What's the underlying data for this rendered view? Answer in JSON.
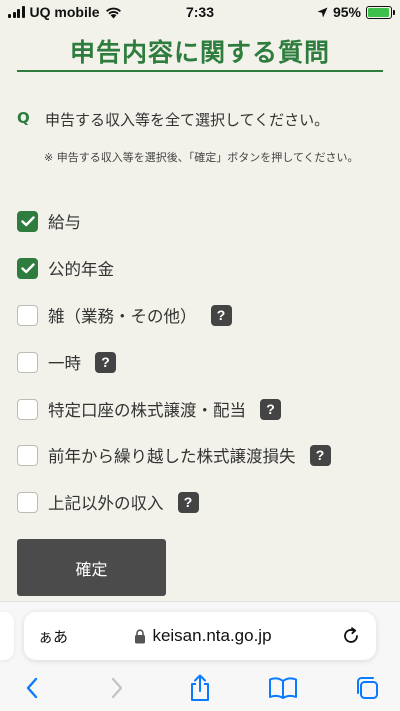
{
  "status_bar": {
    "carrier": "UQ mobile",
    "time": "7:33",
    "battery": "95%",
    "battery_level": 0.95
  },
  "page": {
    "title": "申告内容に関する質問",
    "question_mark": "Q",
    "question": "申告する収入等を全て選択してください。",
    "note": "※ 申告する収入等を選択後、「確定」ボタンを押してください。"
  },
  "options": [
    {
      "label": "給与",
      "checked": true,
      "help": false
    },
    {
      "label": "公的年金",
      "checked": true,
      "help": false
    },
    {
      "label": "雑（業務・その他）",
      "checked": false,
      "help": true
    },
    {
      "label": "一時",
      "checked": false,
      "help": true
    },
    {
      "label": "特定口座の株式譲渡・配当",
      "checked": false,
      "help": true
    },
    {
      "label": "前年から繰り越した株式譲渡損失",
      "checked": false,
      "help": true
    },
    {
      "label": "上記以外の収入",
      "checked": false,
      "help": true
    }
  ],
  "help_glyph": "?",
  "confirm_label": "確定",
  "browser": {
    "aa_label": "ぁあ",
    "url": "keisan.nta.go.jp"
  },
  "colors": {
    "accent": "#2e7d3e",
    "background": "#f2f1ea",
    "button": "#4b4b4b",
    "ios_blue": "#0a7aff"
  }
}
